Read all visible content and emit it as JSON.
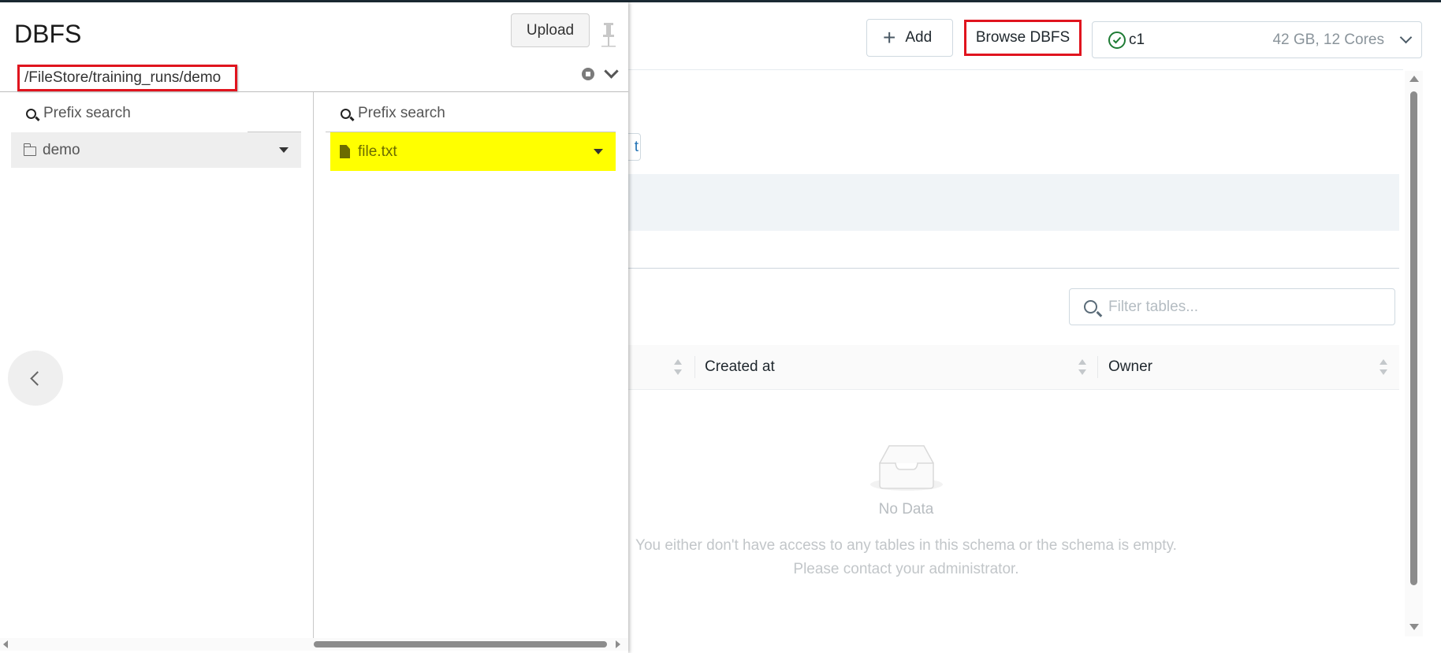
{
  "main": {
    "toolbar": {
      "add_label": "Add",
      "add_icon": "plus-icon",
      "browse_label": "Browse DBFS",
      "cluster": {
        "status_icon": "check-circle-icon",
        "status_color": "#1e7b34",
        "name": "c1",
        "spec": "42 GB, 12 Cores",
        "dropdown_icon": "chevron-down-icon"
      }
    },
    "partial_button_text": "t",
    "filter": {
      "placeholder": "Filter tables...",
      "value": "",
      "icon": "search-icon"
    },
    "table": {
      "columns": [
        "Created at",
        "Owner"
      ],
      "rows": []
    },
    "empty_state": {
      "icon": "empty-inbox-icon",
      "title": "No Data",
      "message_line1": "You either don't have access to any tables in this schema or the schema is empty.",
      "message_line2": "Please contact your administrator."
    }
  },
  "dbfs_panel": {
    "title": "DBFS",
    "upload_label": "Upload",
    "pin_icon": "pin-icon",
    "path": "/FileStore/training_runs/demo",
    "path_highlight_color": "#e0141e",
    "columns": [
      {
        "search_placeholder": "Prefix search",
        "items": [
          {
            "type": "folder",
            "icon": "folder-icon",
            "name": "demo",
            "selected": true
          }
        ]
      },
      {
        "search_placeholder": "Prefix search",
        "items": [
          {
            "type": "file",
            "icon": "file-icon",
            "name": "file.txt",
            "highlight_color": "#ffff00"
          }
        ]
      }
    ]
  }
}
